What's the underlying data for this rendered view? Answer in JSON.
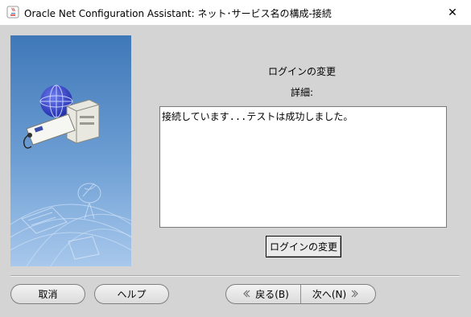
{
  "window": {
    "title": "Oracle Net Configuration Assistant: ネット･サービス名の構成-接続",
    "close_glyph": "✕"
  },
  "main": {
    "heading": "ログインの変更",
    "details_label": "詳細:",
    "details_text": "接続しています...テストは成功しました。",
    "change_login_label": "ログインの変更"
  },
  "footer": {
    "cancel_label": "取消",
    "help_label": "ヘルプ",
    "back_label": "戻る(B)",
    "next_label": "次へ(N)",
    "back_icon": "chevron-left-icon",
    "next_icon": "chevron-right-icon"
  },
  "colors": {
    "window_bg": "#d4d4d4",
    "panel_blue": "#3f78b8"
  }
}
